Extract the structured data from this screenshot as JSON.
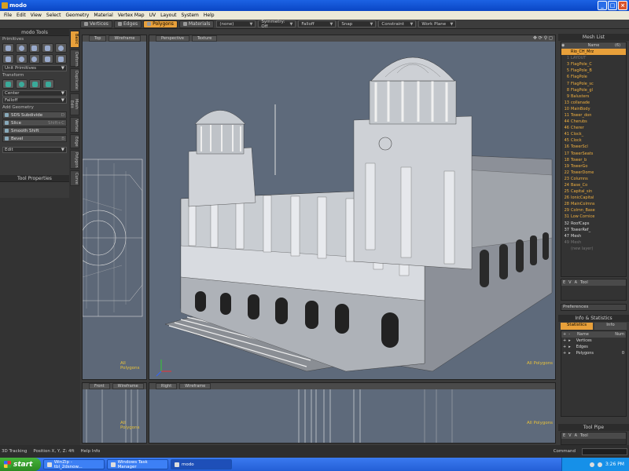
{
  "window": {
    "title": "modo"
  },
  "menu": [
    "File",
    "Edit",
    "View",
    "Select",
    "Geometry",
    "Material",
    "Vertex Map",
    "UV",
    "Layout",
    "System",
    "Help"
  ],
  "toolbar": {
    "tabs": [
      {
        "label": "Vertices",
        "active": false
      },
      {
        "label": "Edges",
        "active": false
      },
      {
        "label": "Polygons",
        "active": true
      },
      {
        "label": "Materials",
        "active": false
      }
    ],
    "dropdowns": [
      "(none)",
      "Symmetry: Off",
      "Falloff",
      "Snap",
      "Constraint",
      "Work Plane"
    ]
  },
  "left_panel": {
    "title": "modo Tools",
    "primitives_label": "Primitives",
    "unit_primitives": "Unit Primitives",
    "transform_label": "Transform",
    "center": "Center",
    "falloff": "Falloff",
    "add_geometry_label": "Add Geometry",
    "geometry_buttons": [
      {
        "label": "SDS Subdivide",
        "shortcut": "D"
      },
      {
        "label": "Slice",
        "shortcut": "Shift+C"
      },
      {
        "label": "Smooth Shift",
        "shortcut": ""
      },
      {
        "label": "Bevel",
        "shortcut": "B"
      }
    ],
    "edit": "Edit",
    "tool_properties": "Tool Properties"
  },
  "vertical_tabs": [
    "Basic",
    "Deform",
    "Duplicate",
    "Mesh Edit",
    "Vertex",
    "Edge",
    "Polygon",
    "Curve"
  ],
  "viewports": {
    "top": {
      "name": "Top",
      "mode": "Wireframe",
      "label": "All Polygons"
    },
    "perspective": {
      "name": "Perspective",
      "mode": "Texture",
      "label": "All Polygons"
    },
    "front": {
      "name": "Front",
      "mode": "Wireframe",
      "label": "All Polygons"
    },
    "right": {
      "name": "Right",
      "mode": "Wireframe",
      "label": "All Polygons"
    }
  },
  "mesh_list": {
    "title": "Mesh List",
    "col_name": "Name",
    "col_count": "(6)",
    "rows": [
      {
        "n": "",
        "name": "Rio_CH_Mrz",
        "type": "top"
      },
      {
        "n": "1",
        "name": "LAYOUT",
        "type": "dim"
      },
      {
        "n": "3",
        "name": "FlagPole_C",
        "type": ""
      },
      {
        "n": "5",
        "name": "FlagPole_B",
        "type": ""
      },
      {
        "n": "6",
        "name": "FlagPole",
        "type": ""
      },
      {
        "n": "7",
        "name": "FlagPole_sc",
        "type": ""
      },
      {
        "n": "8",
        "name": "FlagPole_gl",
        "type": ""
      },
      {
        "n": "9",
        "name": "Balusters",
        "type": ""
      },
      {
        "n": "13",
        "name": "collanade",
        "type": ""
      },
      {
        "n": "10",
        "name": "MainBody",
        "type": ""
      },
      {
        "n": "11",
        "name": "Tower_don",
        "type": ""
      },
      {
        "n": "44",
        "name": "Cherubs",
        "type": ""
      },
      {
        "n": "46",
        "name": "Cherer",
        "type": ""
      },
      {
        "n": "41",
        "name": "Clock_",
        "type": ""
      },
      {
        "n": "45",
        "name": "Clock",
        "type": ""
      },
      {
        "n": "16",
        "name": "TowerScl",
        "type": ""
      },
      {
        "n": "17",
        "name": "TowerSeats",
        "type": ""
      },
      {
        "n": "18",
        "name": "Tower_b",
        "type": ""
      },
      {
        "n": "19",
        "name": "TowerGo",
        "type": ""
      },
      {
        "n": "22",
        "name": "TowerDome",
        "type": ""
      },
      {
        "n": "23",
        "name": "Columns",
        "type": ""
      },
      {
        "n": "24",
        "name": "Base_Co",
        "type": ""
      },
      {
        "n": "25",
        "name": "Capital_sin",
        "type": ""
      },
      {
        "n": "26",
        "name": "IonicCapital",
        "type": ""
      },
      {
        "n": "28",
        "name": "MainColmns",
        "type": ""
      },
      {
        "n": "29",
        "name": "Colmn_Base",
        "type": ""
      },
      {
        "n": "31",
        "name": "Low Cornice",
        "type": ""
      },
      {
        "n": "32",
        "name": "RoofCaps",
        "type": "white"
      },
      {
        "n": "37",
        "name": "TowerRef_",
        "type": "white"
      },
      {
        "n": "47",
        "name": "Mesh",
        "type": "white"
      },
      {
        "n": "49",
        "name": "Mesh",
        "type": "dim"
      },
      {
        "n": "",
        "name": "(new layer)",
        "type": "dim"
      }
    ]
  },
  "vmap": {
    "cols": [
      "E",
      "V",
      "A",
      "Tool"
    ]
  },
  "preferences": "Preferences",
  "info_stats": {
    "title": "Info & Statistics",
    "tabs": [
      "Statistics",
      "Info"
    ],
    "header": [
      "+",
      "-",
      "Name",
      "Num"
    ],
    "rows": [
      {
        "name": "Vertices",
        "num": ""
      },
      {
        "name": "Edges",
        "num": ""
      },
      {
        "name": "Polygons",
        "num": "0"
      }
    ]
  },
  "tool_pipe": {
    "title": "Tool Pipe",
    "cols": [
      "E",
      "V",
      "A",
      "Tool"
    ]
  },
  "command_label": "Command",
  "status": [
    "3D Tracking",
    "Position X, Y, Z:  4ft",
    "Help Info"
  ],
  "taskbar": {
    "start": "start",
    "tasks": [
      {
        "label": "WinZip - tbl_2dsnow...",
        "active": false
      },
      {
        "label": "Windows Task Manager",
        "active": false
      },
      {
        "label": "modo",
        "active": true
      }
    ],
    "time": "3:26 PM"
  }
}
